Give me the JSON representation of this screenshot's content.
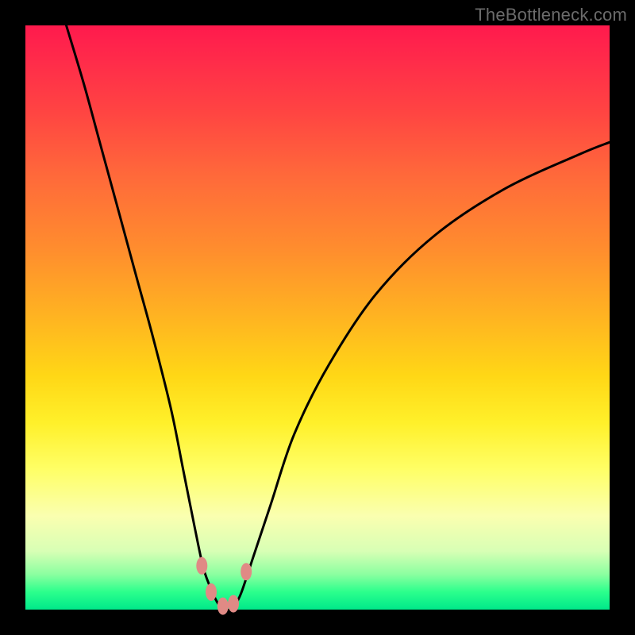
{
  "watermark": "TheBottleneck.com",
  "chart_data": {
    "type": "line",
    "title": "",
    "xlabel": "",
    "ylabel": "",
    "xlim": [
      0,
      100
    ],
    "ylim": [
      0,
      100
    ],
    "series": [
      {
        "name": "bottleneck-curve",
        "x": [
          7,
          10,
          13,
          16,
          19,
          22,
          25,
          27,
          29,
          30.5,
          32,
          33,
          34,
          35,
          36,
          37,
          39,
          42,
          46,
          52,
          60,
          70,
          82,
          95,
          100
        ],
        "y": [
          100,
          90,
          79,
          68,
          57,
          46,
          34,
          24,
          14,
          7,
          3,
          1,
          0,
          0,
          1,
          3,
          9,
          18,
          30,
          42,
          54,
          64,
          72,
          78,
          80
        ]
      }
    ],
    "annotations": [
      {
        "name": "marker-left-upper",
        "x": 30.2,
        "y": 7.5,
        "color": "#e08a85"
      },
      {
        "name": "marker-left-lower",
        "x": 31.8,
        "y": 3.0,
        "color": "#e08a85"
      },
      {
        "name": "marker-bottom-left",
        "x": 33.8,
        "y": 0.6,
        "color": "#e08a85"
      },
      {
        "name": "marker-bottom-right",
        "x": 35.6,
        "y": 1.0,
        "color": "#e08a85"
      },
      {
        "name": "marker-right",
        "x": 37.8,
        "y": 6.5,
        "color": "#e08a85"
      }
    ]
  }
}
